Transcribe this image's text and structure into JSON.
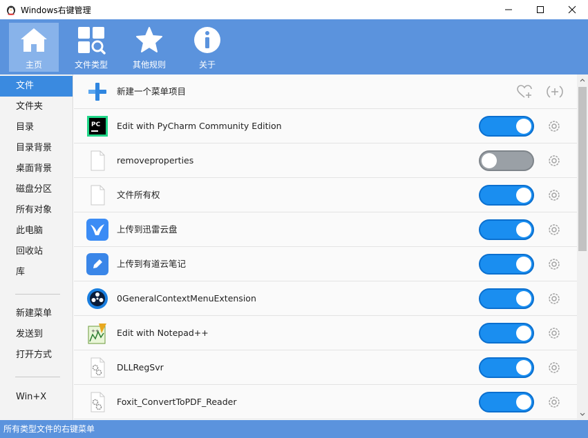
{
  "window": {
    "title": "Windows右键管理",
    "icon": "penguin-app-icon",
    "controls": [
      "minimize-icon",
      "maximize-icon",
      "close-icon"
    ]
  },
  "toolbar": {
    "background": "#5b93dd",
    "items": [
      {
        "label": "主页",
        "icon": "home-icon",
        "active": true
      },
      {
        "label": "文件类型",
        "icon": "file-type-search-icon",
        "active": false
      },
      {
        "label": "其他规则",
        "icon": "star-icon",
        "active": false
      },
      {
        "label": "关于",
        "icon": "info-icon",
        "active": false
      }
    ]
  },
  "sidebar": {
    "items": [
      {
        "label": "文件",
        "active": true
      },
      {
        "label": "文件夹"
      },
      {
        "label": "目录"
      },
      {
        "label": "目录背景"
      },
      {
        "label": "桌面背景"
      },
      {
        "label": "磁盘分区"
      },
      {
        "label": "所有对象"
      },
      {
        "label": "此电脑"
      },
      {
        "label": "回收站"
      },
      {
        "label": "库"
      },
      {
        "label": "新建菜单"
      },
      {
        "label": "发送到"
      },
      {
        "label": "打开方式"
      },
      {
        "label": "Win+X"
      }
    ]
  },
  "content": {
    "new_item": {
      "label": "新建一个菜单项目",
      "icon": "plus-icon"
    },
    "rows": [
      {
        "label": "Edit with PyCharm Community Edition",
        "icon": "pycharm-icon",
        "enabled": true
      },
      {
        "label": "removeproperties",
        "icon": "blank-file-icon",
        "enabled": false
      },
      {
        "label": "文件所有权",
        "icon": "blank-file-icon",
        "enabled": true
      },
      {
        "label": "上传到迅雷云盘",
        "icon": "xunlei-bird-icon",
        "enabled": true
      },
      {
        "label": "上传到有道云笔记",
        "icon": "youdao-note-icon",
        "enabled": true
      },
      {
        "label": "0GeneralContextMenuExtension",
        "icon": "film-reel-icon",
        "enabled": true
      },
      {
        "label": "Edit with Notepad++",
        "icon": "notepadpp-icon",
        "enabled": true
      },
      {
        "label": "DLLRegSvr",
        "icon": "gear-file-icon",
        "enabled": true
      },
      {
        "label": "Foxit_ConvertToPDF_Reader",
        "icon": "gear-file-icon",
        "enabled": true
      }
    ]
  },
  "status": {
    "text": "所有类型文件的右键菜单"
  },
  "colors": {
    "accent": "#3a8ae0",
    "toggle_on": "#1a8ef0",
    "toggle_off": "#9aa0a6"
  }
}
